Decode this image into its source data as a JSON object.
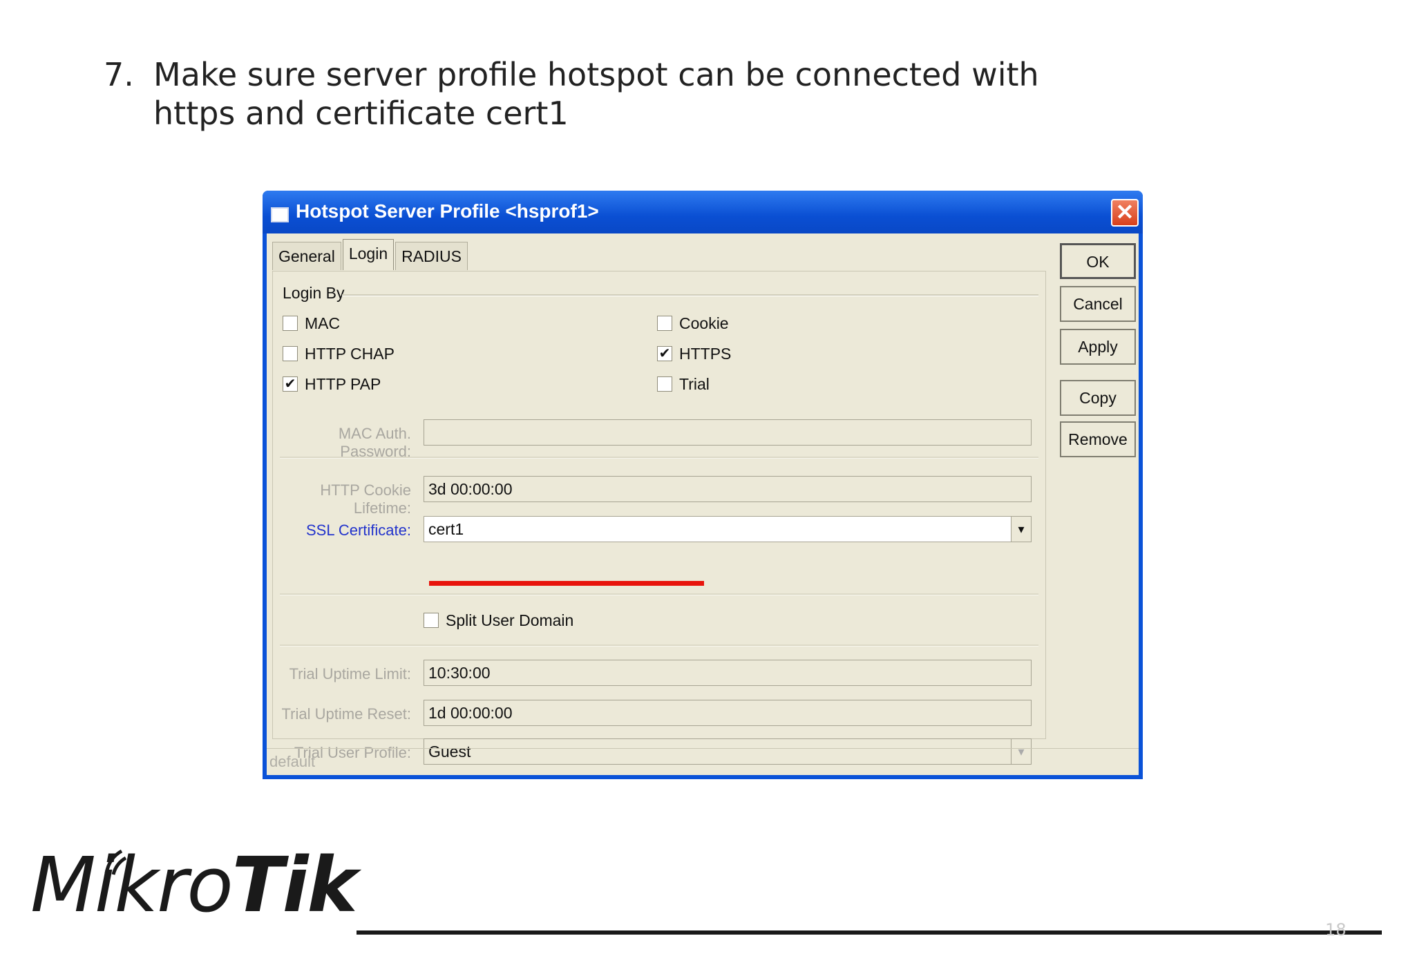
{
  "slide": {
    "number": "7.",
    "title_line1": "Make sure server profile hotspot  can be connected  with",
    "title_line2": "https and certificate cert1",
    "page_number": "18",
    "logo_light": "Mikro",
    "logo_bold": "Tik"
  },
  "window": {
    "title": "Hotspot Server Profile <hsprof1>",
    "close_glyph": "✕",
    "tabs": [
      {
        "label": "General",
        "active": false
      },
      {
        "label": "Login",
        "active": true
      },
      {
        "label": "RADIUS",
        "active": false
      }
    ],
    "login_by": {
      "group_label": "Login By",
      "options": [
        {
          "label": "MAC",
          "checked": false
        },
        {
          "label": "HTTP CHAP",
          "checked": false
        },
        {
          "label": "HTTP PAP",
          "checked": true
        },
        {
          "label": "Cookie",
          "checked": false
        },
        {
          "label": "HTTPS",
          "checked": true
        },
        {
          "label": "Trial",
          "checked": false
        }
      ]
    },
    "check_glyph": "✔",
    "fields": {
      "mac_auth_password": {
        "label": "MAC Auth. Password:",
        "value": ""
      },
      "http_cookie_lifetime": {
        "label": "HTTP Cookie Lifetime:",
        "value": "3d 00:00:00"
      },
      "ssl_certificate": {
        "label": "SSL Certificate:",
        "value": "cert1"
      },
      "split_user_domain": {
        "label": "Split User Domain",
        "checked": false
      },
      "trial_uptime_limit": {
        "label": "Trial Uptime Limit:",
        "value": "10:30:00"
      },
      "trial_uptime_reset": {
        "label": "Trial Uptime Reset:",
        "value": "1d 00:00:00"
      },
      "trial_user_profile": {
        "label": "Trial User Profile:",
        "value": "Guest"
      }
    },
    "dropdown_glyph": "▾",
    "buttons": {
      "ok": "OK",
      "cancel": "Cancel",
      "apply": "Apply",
      "copy": "Copy",
      "remove": "Remove"
    },
    "status": "default"
  },
  "colors": {
    "titlebar": "#0a52d8",
    "dialog_bg": "#ece9d8",
    "highlight_underline": "#e8140c",
    "enabled_label": "#2233cc",
    "disabled_label": "#a9a7a0"
  }
}
